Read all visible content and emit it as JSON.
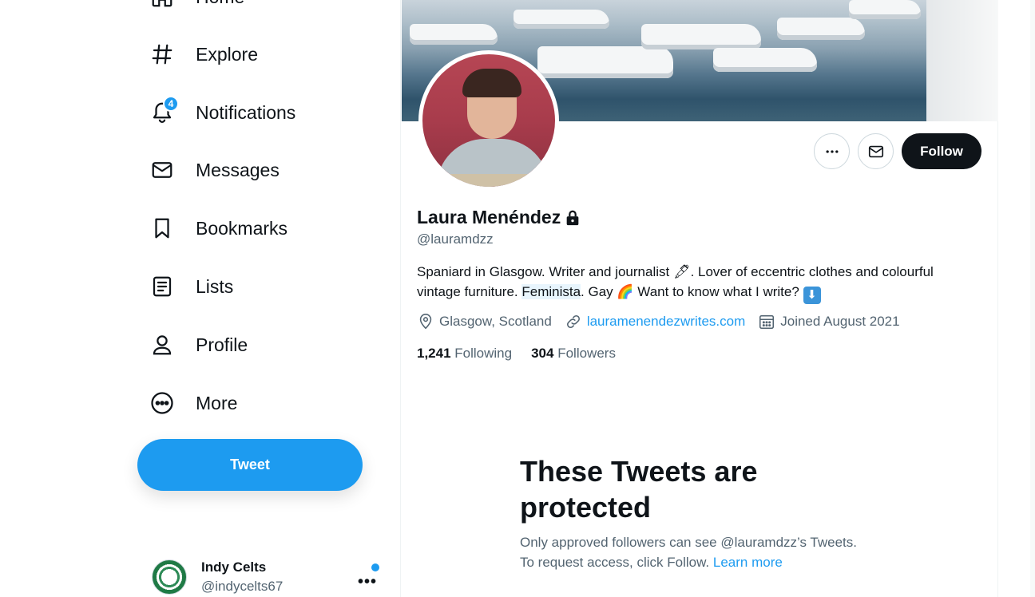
{
  "sidebar": {
    "items": [
      {
        "label": "Home",
        "icon": "home-icon"
      },
      {
        "label": "Explore",
        "icon": "hashtag-icon"
      },
      {
        "label": "Notifications",
        "icon": "bell-icon",
        "badge": "4"
      },
      {
        "label": "Messages",
        "icon": "envelope-icon"
      },
      {
        "label": "Bookmarks",
        "icon": "bookmark-icon"
      },
      {
        "label": "Lists",
        "icon": "list-icon"
      },
      {
        "label": "Profile",
        "icon": "person-icon"
      },
      {
        "label": "More",
        "icon": "more-circle-icon"
      }
    ],
    "tweet_label": "Tweet",
    "account": {
      "name": "Indy Celts",
      "handle": "@indycelts67"
    }
  },
  "profile": {
    "name": "Laura Menéndez",
    "handle": "@lauramdzz",
    "bio": {
      "part1": "Spaniard in Glasgow. Writer and journalist ",
      "emoji1": "🖋",
      "part2": ". Lover of eccentric clothes and colourful vintage furniture. ",
      "highlight": "Feminista",
      "part3": ". Gay ",
      "emoji2": "🌈",
      "part4": " Want to know what I write? ",
      "emoji3": "⬇"
    },
    "location": "Glasgow, Scotland",
    "website": "lauramenendezwrites.com",
    "joined": "Joined August 2021",
    "following_count": "1,241",
    "following_label": "Following",
    "followers_count": "304",
    "followers_label": "Followers",
    "follow_label": "Follow"
  },
  "protected": {
    "title": "These Tweets are protected",
    "text": "Only approved followers can see @lauramdzz’s Tweets. To request access, click Follow. ",
    "learn_more": "Learn more"
  },
  "colors": {
    "accent": "#1d9bf0",
    "text": "#0f1419",
    "secondary": "#536471"
  }
}
